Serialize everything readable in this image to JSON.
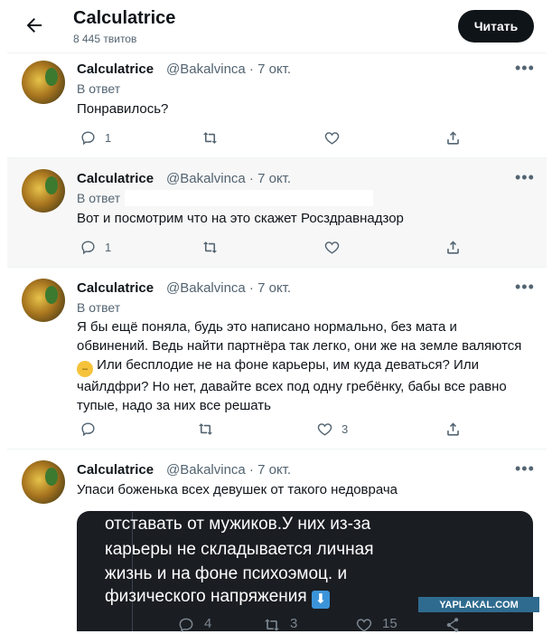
{
  "header": {
    "title": "Calculatrice",
    "subtitle": "8 445 твитов",
    "follow_label": "Читать"
  },
  "tweets": [
    {
      "name": "Calculatrice",
      "handle": "@Bakalvinca · 7 окт.",
      "reply_label": "В ответ",
      "text": "Понравилось?",
      "reply_count": "1",
      "retweet_count": "",
      "like_count": ""
    },
    {
      "name": "Calculatrice",
      "handle": "@Bakalvinca · 7 окт.",
      "reply_label": "В ответ",
      "text": "Вот и посмотрим что на это скажет Росздравнадзор",
      "reply_count": "1",
      "retweet_count": "",
      "like_count": ""
    },
    {
      "name": "Calculatrice",
      "handle": "@Bakalvinca · 7 окт.",
      "reply_label": "В ответ",
      "text_lines": [
        "Я бы ещё поняла, будь это написано нормально, без мата и",
        "обвинений. Ведь найти партнёра так легко, они же на земле валяются",
        "Или бесплодие не на фоне карьеры, им куда деваться? Или",
        "чайлдфри? Но нет, давайте всех под одну гребёнку, бабы все равно",
        "тупые, надо за них все решать"
      ],
      "emoji": "😑",
      "reply_count": "",
      "retweet_count": "",
      "like_count": "3"
    },
    {
      "name": "Calculatrice",
      "handle": "@Bakalvinca · 7 окт.",
      "text": "Упаси боженька всех девушек от такого недоврача",
      "media_lines": [
        "отставать от мужиков.У них из-за",
        "карьеры не складывается личная",
        "жизнь и на фоне  психоэмоц. и",
        "физического напряжения"
      ],
      "media_icon": "⬇",
      "media_counts": {
        "reply": "4",
        "retweet": "3",
        "like": "15"
      }
    }
  ],
  "watermark": "YAPLAKAL.COM",
  "icons": [
    "back-arrow-icon",
    "more-icon",
    "reply-icon",
    "retweet-icon",
    "like-icon",
    "share-icon",
    "download-icon"
  ]
}
